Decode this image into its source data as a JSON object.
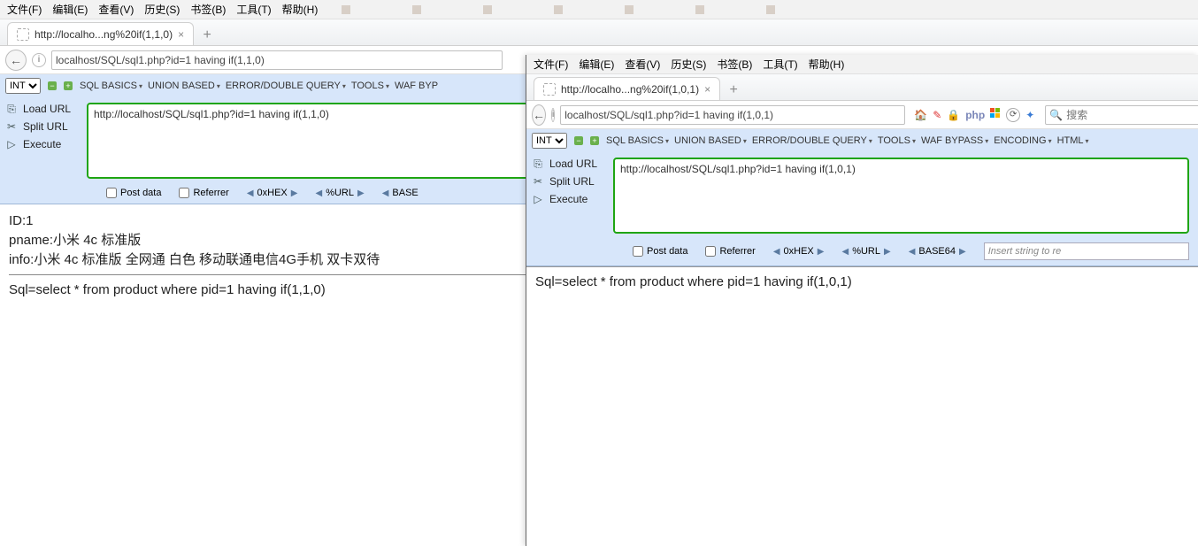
{
  "left": {
    "menus": [
      "文件(F)",
      "编辑(E)",
      "查看(V)",
      "历史(S)",
      "书签(B)",
      "工具(T)",
      "帮助(H)"
    ],
    "tab_title": "http://localho...ng%20if(1,1,0)",
    "address": "localhost/SQL/sql1.php?id=1 having if(1,1,0)",
    "int_label": "INT",
    "hb_menus": [
      "SQL BASICS",
      "UNION BASED",
      "ERROR/DOUBLE QUERY",
      "TOOLS",
      "WAF BYP"
    ],
    "actions": {
      "load": "Load URL",
      "split": "Split URL",
      "exec": "Execute"
    },
    "url_value": "http://localhost/SQL/sql1.php?id=1 having if(1,1,0)",
    "checks": {
      "post": "Post data",
      "ref": "Referrer"
    },
    "pills": [
      "0xHEX",
      "%URL",
      "BASE"
    ],
    "result": {
      "id": "ID:1",
      "pname": "pname:小米 4c 标准版",
      "info": "info:小米 4c 标准版 全网通 白色 移动联通电信4G手机 双卡双待",
      "sql": "Sql=select * from product where pid=1 having if(1,1,0)"
    }
  },
  "right": {
    "menus": [
      "文件(F)",
      "编辑(E)",
      "查看(V)",
      "历史(S)",
      "书签(B)",
      "工具(T)",
      "帮助(H)"
    ],
    "tab_title": "http://localho...ng%20if(1,0,1)",
    "address": "localhost/SQL/sql1.php?id=1 having if(1,0,1)",
    "search_placeholder": "搜索",
    "int_label": "INT",
    "hb_menus": [
      "SQL BASICS",
      "UNION BASED",
      "ERROR/DOUBLE QUERY",
      "TOOLS",
      "WAF BYPASS",
      "ENCODING",
      "HTML"
    ],
    "actions": {
      "load": "Load URL",
      "split": "Split URL",
      "exec": "Execute"
    },
    "url_value": "http://localhost/SQL/sql1.php?id=1 having if(1,0,1)",
    "checks": {
      "post": "Post data",
      "ref": "Referrer"
    },
    "pills": [
      "0xHEX",
      "%URL",
      "BASE64"
    ],
    "insert_placeholder": "Insert string to re",
    "result": {
      "sql": "Sql=select * from product where pid=1 having if(1,0,1)"
    }
  }
}
